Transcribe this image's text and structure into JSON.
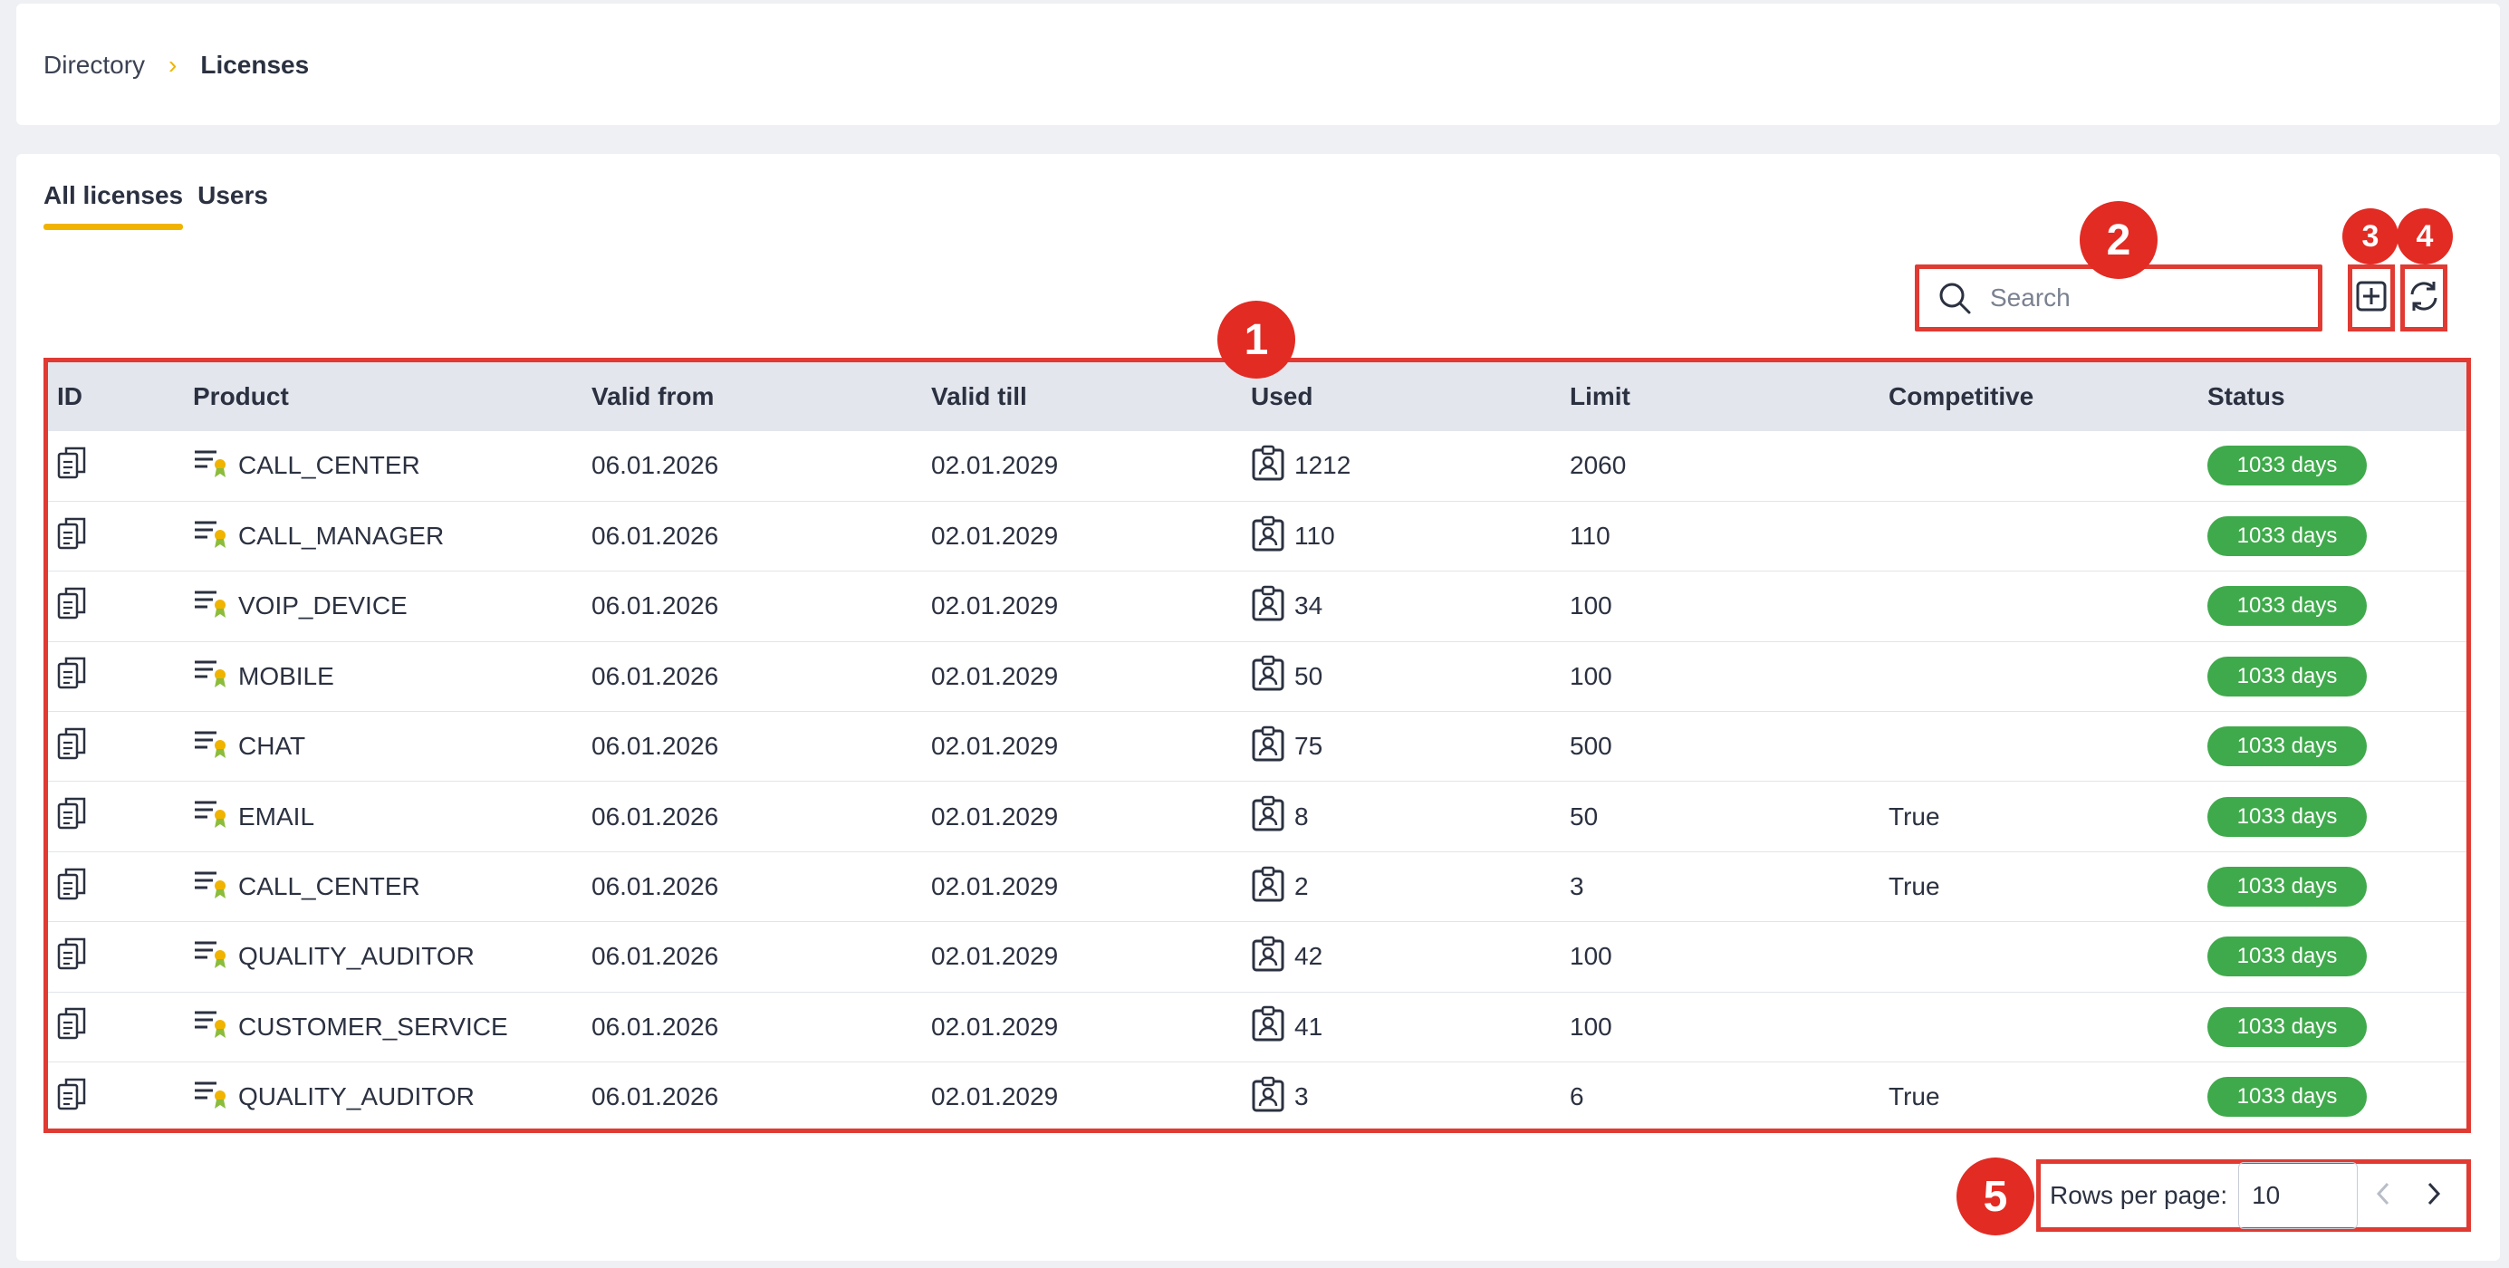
{
  "breadcrumb": {
    "parent": "Directory",
    "separator": "›",
    "current": "Licenses"
  },
  "tabs": [
    {
      "label": "All licenses",
      "active": true
    },
    {
      "label": "Users",
      "active": false
    }
  ],
  "search": {
    "placeholder": "Search",
    "value": ""
  },
  "table": {
    "columns": [
      "ID",
      "Product",
      "Valid from",
      "Valid till",
      "Used",
      "Limit",
      "Competitive",
      "Status"
    ],
    "rows": [
      {
        "product": "CALL_CENTER",
        "valid_from": "06.01.2026",
        "valid_till": "02.01.2029",
        "used": "1212",
        "limit": "2060",
        "competitive": "",
        "status": "1033 days"
      },
      {
        "product": "CALL_MANAGER",
        "valid_from": "06.01.2026",
        "valid_till": "02.01.2029",
        "used": "110",
        "limit": "110",
        "competitive": "",
        "status": "1033 days"
      },
      {
        "product": "VOIP_DEVICE",
        "valid_from": "06.01.2026",
        "valid_till": "02.01.2029",
        "used": "34",
        "limit": "100",
        "competitive": "",
        "status": "1033 days"
      },
      {
        "product": "MOBILE",
        "valid_from": "06.01.2026",
        "valid_till": "02.01.2029",
        "used": "50",
        "limit": "100",
        "competitive": "",
        "status": "1033 days"
      },
      {
        "product": "CHAT",
        "valid_from": "06.01.2026",
        "valid_till": "02.01.2029",
        "used": "75",
        "limit": "500",
        "competitive": "",
        "status": "1033 days"
      },
      {
        "product": "EMAIL",
        "valid_from": "06.01.2026",
        "valid_till": "02.01.2029",
        "used": "8",
        "limit": "50",
        "competitive": "True",
        "status": "1033 days"
      },
      {
        "product": "CALL_CENTER",
        "valid_from": "06.01.2026",
        "valid_till": "02.01.2029",
        "used": "2",
        "limit": "3",
        "competitive": "True",
        "status": "1033 days"
      },
      {
        "product": "QUALITY_AUDITOR",
        "valid_from": "06.01.2026",
        "valid_till": "02.01.2029",
        "used": "42",
        "limit": "100",
        "competitive": "",
        "status": "1033 days"
      },
      {
        "product": "CUSTOMER_SERVICE",
        "valid_from": "06.01.2026",
        "valid_till": "02.01.2029",
        "used": "41",
        "limit": "100",
        "competitive": "",
        "status": "1033 days"
      },
      {
        "product": "QUALITY_AUDITOR",
        "valid_from": "06.01.2026",
        "valid_till": "02.01.2029",
        "used": "3",
        "limit": "6",
        "competitive": "True",
        "status": "1033 days"
      }
    ]
  },
  "pagination": {
    "label": "Rows per page:",
    "rows_per_page": "10"
  },
  "markers": [
    "1",
    "2",
    "3",
    "4",
    "5"
  ],
  "icons": {
    "id": "copy-icon",
    "product": "license-icon",
    "used": "user-badge-icon",
    "add": "plus-square-icon",
    "refresh": "refresh-icon",
    "search": "search-icon",
    "prev": "chevron-left-icon",
    "next": "chevron-right-icon"
  },
  "colors": {
    "accent": "#f0b400",
    "status_badge": "#3faa4b",
    "annotation": "#e03a32"
  }
}
